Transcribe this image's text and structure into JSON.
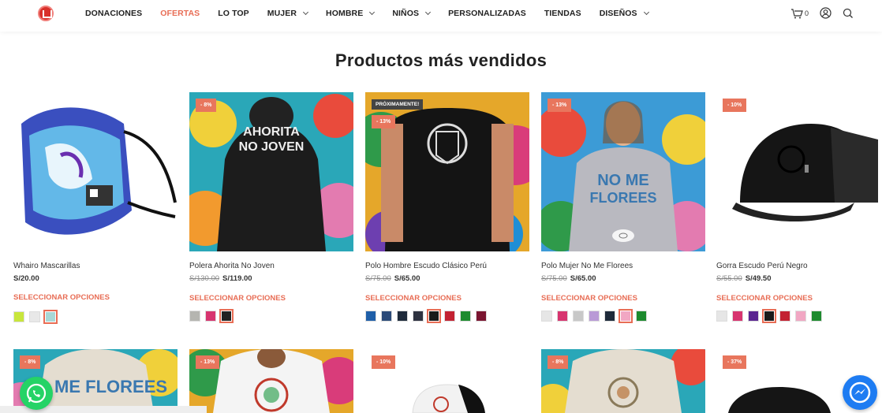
{
  "nav": {
    "items": [
      {
        "label": "DONACIONES",
        "active": false,
        "dropdown": false
      },
      {
        "label": "OFERTAS",
        "active": true,
        "dropdown": false
      },
      {
        "label": "LO TOP",
        "active": false,
        "dropdown": false
      },
      {
        "label": "MUJER",
        "active": false,
        "dropdown": true
      },
      {
        "label": "HOMBRE",
        "active": false,
        "dropdown": true
      },
      {
        "label": "NIÑOS",
        "active": false,
        "dropdown": true
      },
      {
        "label": "PERSONALIZADAS",
        "active": false,
        "dropdown": false
      },
      {
        "label": "TIENDAS",
        "active": false,
        "dropdown": false
      },
      {
        "label": "DISEÑOS",
        "active": false,
        "dropdown": true
      }
    ],
    "cart_count": "0"
  },
  "section": {
    "title": "Productos más vendidos"
  },
  "products": [
    {
      "name": "Whairo Mascarillas",
      "old_price": "",
      "price": "S/20.00",
      "select": "SELECCIONAR OPCIONES",
      "badge": "",
      "swatches": [
        "#c8e63c",
        "#e8e8e8",
        "#a8d8d6"
      ],
      "selected": 2
    },
    {
      "name": "Polera Ahorita No Joven",
      "old_price": "S/130.00",
      "price": "S/119.00",
      "select": "SELECCIONAR OPCIONES",
      "badge": "- 8%",
      "image_text": "AHORITA NO JOVEN",
      "swatches": [
        "#b5b5b0",
        "#d7346f",
        "#222222"
      ],
      "selected": 2
    },
    {
      "name": "Polo Hombre Escudo Clásico Perú",
      "old_price": "S/75.00",
      "price": "S/65.00",
      "select": "SELECCIONAR OPCIONES",
      "badge": "- 13%",
      "badge_soon": "PRÓXIMAMENTE!",
      "swatches": [
        "#1f5fa8",
        "#2b4a78",
        "#1e2a3a",
        "#2e3240",
        "#1a1a1a",
        "#c32232",
        "#1d8a2e",
        "#7a1530"
      ],
      "selected": 4
    },
    {
      "name": "Polo Mujer No Me Florees",
      "old_price": "S/75.00",
      "price": "S/65.00",
      "select": "SELECCIONAR OPCIONES",
      "badge": "- 13%",
      "image_text": "NO ME FLOREES",
      "swatches": [
        "#e6e6e6",
        "#d7346f",
        "#c8c8c8",
        "#b99ad6",
        "#1e2a3a",
        "#f1a7c3",
        "#1d8a2e"
      ],
      "selected": 5
    },
    {
      "name": "Gorra Escudo Perú Negro",
      "old_price": "S/55.00",
      "price": "S/49.50",
      "select": "SELECCIONAR OPCIONES",
      "badge": "- 10%",
      "swatches": [
        "#e6e6e6",
        "#d7346f",
        "#5a2590",
        "#1a1a1a",
        "#c32232",
        "#f1a7c3",
        "#1d8a2e"
      ],
      "selected": 3
    }
  ],
  "second_row_badges": [
    "- 8%",
    "- 13%",
    "- 10%",
    "- 8%",
    "- 37%"
  ],
  "second_row_image_text": "NO ME FLOREES",
  "colors": {
    "accent": "#e86d55",
    "whatsapp": "#25d366",
    "messenger": "#1e7cf2"
  }
}
